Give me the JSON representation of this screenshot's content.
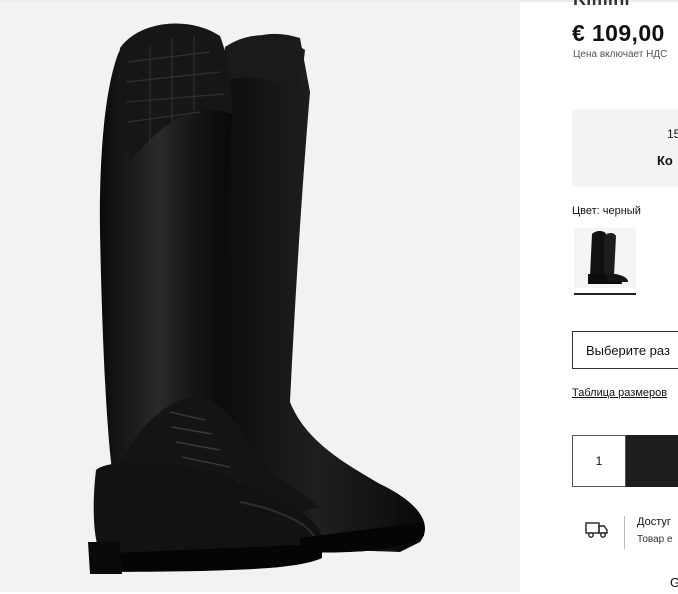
{
  "product": {
    "title_partial": "Kimini",
    "price": "€ 109,00",
    "vat_note": "Цена включает НДС",
    "image_icon": "riding-boots-photo"
  },
  "promo": {
    "line1": "15",
    "line2": "Ко"
  },
  "color": {
    "label": "Цвет: черный",
    "swatch_icon": "black-riding-boots-thumbnail"
  },
  "size": {
    "select_label": "Выберите раз",
    "table_link": "Таблица размеров"
  },
  "cart": {
    "quantity": "1",
    "button_color": "#1e1e1e"
  },
  "delivery": {
    "icon": "delivery-truck-icon",
    "title": "Достуг",
    "subtitle": "Товар е"
  },
  "footer_partial": "G"
}
